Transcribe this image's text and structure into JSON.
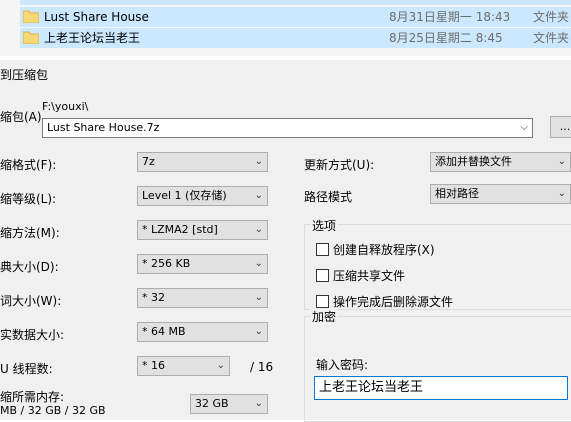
{
  "file_list": {
    "rows": [
      {
        "name": "Lust Share House",
        "date": "8月31日星期一 18:43",
        "type": "文件夹"
      },
      {
        "name": "上老王论坛当老王",
        "date": "8月25日星期二 8:45",
        "type": "文件夹"
      }
    ]
  },
  "dialog": {
    "title": "到压缩包",
    "archive": {
      "label": "缩包(A)",
      "path": "F:\\youxi\\",
      "filename": "Lust Share House.7z",
      "browse_label": "..."
    },
    "left": {
      "format": {
        "label": "缩格式(F):",
        "value": "7z"
      },
      "level": {
        "label": "缩等级(L):",
        "value": "Level 1 (仅存储)"
      },
      "method": {
        "label": "缩方法(M):",
        "value": "* LZMA2 [std]"
      },
      "dict": {
        "label": "典大小(D):",
        "value": "* 256 KB"
      },
      "word": {
        "label": "词大小(W):",
        "value": "* 32"
      },
      "solid": {
        "label": "实数据大小:",
        "value": "* 64 MB"
      },
      "threads": {
        "label": "U 线程数:",
        "value": "* 16",
        "max": "/ 16"
      },
      "memory": {
        "label": "缩所需内存:",
        "info": "MB / 32 GB / 32 GB",
        "value": "32 GB"
      }
    },
    "right": {
      "update": {
        "label": "更新方式(U):",
        "value": "添加并替换文件"
      },
      "pathmode": {
        "label": "路径模式",
        "value": "相对路径"
      },
      "options": {
        "title": "选项",
        "items": [
          "创建自释放程序(X)",
          "压缩共享文件",
          "操作完成后删除源文件"
        ]
      },
      "encryption": {
        "title": "加密",
        "password_label": "输入密码:",
        "password_value": "上老王论坛当老王"
      }
    }
  },
  "colors": {
    "selection": "#cce8ff",
    "dialog_bg": "#f0f0f0",
    "focus": "#0078d7"
  }
}
